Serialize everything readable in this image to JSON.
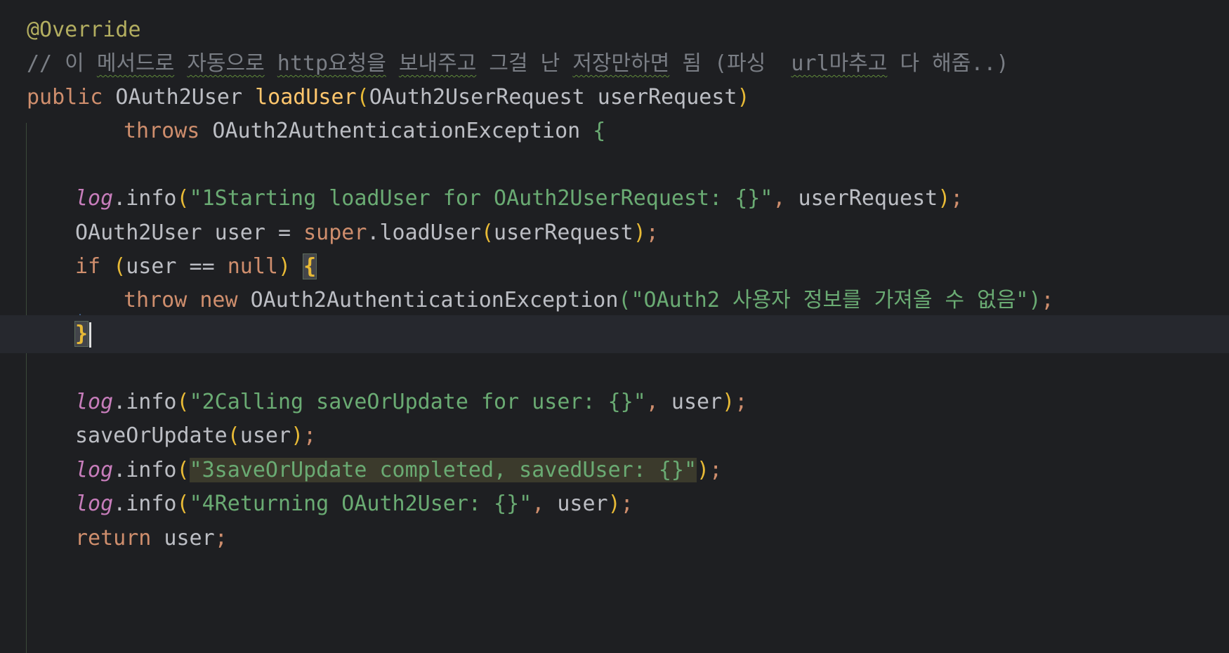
{
  "editor": {
    "lines": {
      "l1": {
        "annotation": "@Override"
      },
      "l2": {
        "p1": "// 이 ",
        "p2": "메서드로",
        "p3": " ",
        "p4": "자동으로",
        "p5": " ",
        "p6": "http요청을",
        "p7": " ",
        "p8": "보내주고",
        "p9": " 그걸 난 ",
        "p10": "저장만하면",
        "p11": " 됨 (파싱  ",
        "p12": "url마추고",
        "p13": " 다 해줌..)"
      },
      "l3": {
        "kw": "public",
        "type": " OAuth2User ",
        "fn": "loadUser",
        "open": "(",
        "args": "OAuth2UserRequest userRequest",
        "close": ")"
      },
      "l4": {
        "kw": "throws",
        "type": " OAuth2AuthenticationException ",
        "brace": "{"
      },
      "l5": {
        "field": "log",
        "call": ".info",
        "open": "(",
        "str": "\"1Starting loadUser for OAuth2UserRequest: {}\"",
        "comma": ", ",
        "arg": "userRequest",
        "close": ")",
        "semi": ";"
      },
      "l6": {
        "text1": "OAuth2User user = ",
        "kw": "super",
        "call": ".loadUser",
        "open": "(",
        "arg": "userRequest",
        "close": ")",
        "semi": ";"
      },
      "l7": {
        "kw": "if",
        "sp": " ",
        "open": "(",
        "cond": "user == ",
        "null": "null",
        "close": ")",
        "sp2": " ",
        "brace": "{"
      },
      "l8": {
        "kw1": "throw",
        "kw2": " new",
        "type": " OAuth2AuthenticationException",
        "open": "(",
        "str": "\"OAuth2 사용자 정보를 가져올 수 없음\"",
        "close": ")",
        "semi": ";"
      },
      "l9": {
        "brace": "}"
      },
      "l10": {
        "field": "log",
        "call": ".info",
        "open": "(",
        "str": "\"2Calling saveOrUpdate for user: {}\"",
        "comma": ", ",
        "arg": "user",
        "close": ")",
        "semi": ";"
      },
      "l11": {
        "call": "saveOrUpdate",
        "open": "(",
        "arg": "user",
        "close": ")",
        "semi": ";"
      },
      "l12": {
        "field": "log",
        "call": ".info",
        "open": "(",
        "str": "\"3saveOrUpdate completed, savedUser: {}\"",
        "close": ")",
        "semi": ";"
      },
      "l13": {
        "field": "log",
        "call": ".info",
        "open": "(",
        "str": "\"4Returning OAuth2User: {}\"",
        "comma": ", ",
        "arg": "user",
        "close": ")",
        "semi": ";"
      },
      "l14": {
        "kw": "return",
        "text": " user",
        "semi": ";"
      }
    }
  }
}
